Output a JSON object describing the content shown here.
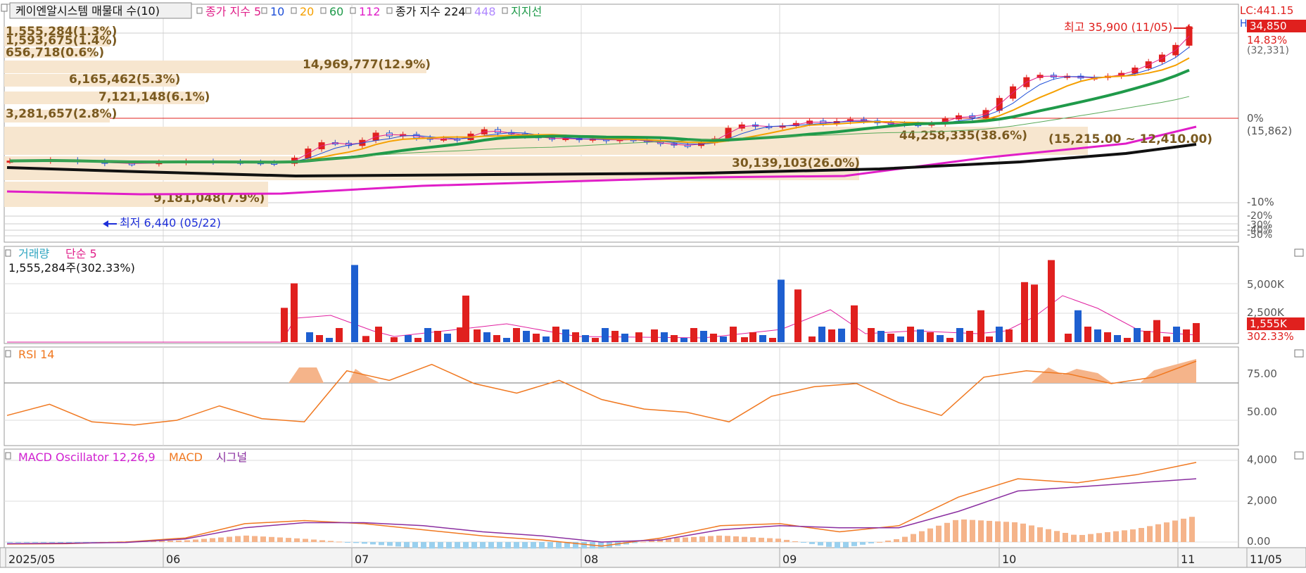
{
  "price_header": {
    "title": "케이엔알시스템 매물대 수(10)",
    "items": [
      {
        "label": "종가 지수 5",
        "color": "#e0208a"
      },
      {
        "label": "10",
        "color": "#1e4fd8"
      },
      {
        "label": "20",
        "color": "#f5a000"
      },
      {
        "label": "60",
        "color": "#1f9a4a"
      },
      {
        "label": "112",
        "color": "#e01ec8"
      },
      {
        "label": "종가 지수 224",
        "color": "#111111"
      },
      {
        "label": "448",
        "color": "#b088ff"
      },
      {
        "label": "지지선",
        "color": "#1f9a4a"
      }
    ]
  },
  "price_right": {
    "lc": "LC:441.15",
    "h": "H",
    "current": "34,850",
    "pct": "14.83%",
    "sub": "(32,331)",
    "zero": "0%",
    "zero_val": "(15,862)",
    "m10": "-10%",
    "m20": "-20%",
    "m30": "-30%",
    "m40": "-40%",
    "m50": "-50%"
  },
  "volume_profile": [
    "1,555,284(1.3%)",
    "1,593,675(1.4%)",
    "656,718(0.6%)",
    "14,969,777(12.9%)",
    "6,165,462(5.3%)",
    "7,121,148(6.1%)",
    "3,281,657(2.8%)",
    "44,258,335(38.6%)",
    "30,139,103(26.0%)",
    "9,181,048(7.9%)"
  ],
  "annotations": {
    "high": "최고 35,900 (11/05)",
    "low": "최저 6,440 (05/22)",
    "range": "(15,215.00 ~ 12,410.00)"
  },
  "volume_panel": {
    "title": "거래량",
    "ma_label": "단순 5",
    "value": "1,555,284주(302.33%)",
    "ticks": [
      "5,000K",
      "2,500K"
    ],
    "cur": "1,555K",
    "cur_pct": "302.33%"
  },
  "rsi_panel": {
    "title": "RSI 14",
    "ticks": [
      "75.00",
      "50.00"
    ]
  },
  "macd_panel": {
    "title1": "MACD Oscillator 12,26,9",
    "title2": "MACD",
    "title3": "시그널",
    "ticks": [
      "4,000",
      "2,000",
      "0.00"
    ]
  },
  "x_axis": {
    "labels": [
      "2025/05",
      "06",
      "07",
      "08",
      "09",
      "10",
      "11",
      "11/05"
    ]
  },
  "chart_data": [
    {
      "type": "candlestick",
      "title": "케이엔알시스템",
      "x": [
        "2025/05",
        "06",
        "07",
        "08",
        "09",
        "10",
        "11"
      ],
      "series": [
        {
          "name": "종가 지수 5",
          "values": [
            6900,
            6700,
            11500,
            12000,
            13000,
            14000,
            20000,
            27500,
            31000
          ]
        },
        {
          "name": "224",
          "values": [
            11000,
            10600,
            10500,
            10800,
            11200,
            11300,
            11700,
            13600,
            14600
          ]
        }
      ],
      "annotations": {
        "high": 35900,
        "high_date": "11/05",
        "low": 6440,
        "low_date": "05/22",
        "current": 34850,
        "change_pct": 14.83
      }
    },
    {
      "type": "bar",
      "title": "거래량",
      "values_k": [
        0,
        0,
        2800,
        4800,
        6300,
        500,
        400,
        1200,
        3800,
        800,
        400,
        5100,
        4300,
        1100,
        3000,
        2600,
        4900,
        4700,
        6700,
        2600,
        1800,
        1555
      ],
      "ylim_k": [
        0,
        6900
      ]
    },
    {
      "type": "line",
      "title": "RSI 14",
      "ylim": [
        30,
        90
      ],
      "values": [
        48,
        55,
        44,
        42,
        45,
        54,
        46,
        44,
        76,
        70,
        80,
        68,
        62,
        70,
        58,
        52,
        50,
        44,
        60,
        66,
        68,
        56,
        48,
        72,
        76,
        74,
        68,
        72,
        82
      ]
    },
    {
      "type": "line",
      "title": "MACD Oscillator 12,26,9",
      "ylim": [
        -500,
        4300
      ],
      "series": [
        {
          "name": "MACD",
          "values": [
            -100,
            -80,
            0,
            200,
            900,
            1050,
            900,
            600,
            300,
            100,
            -200,
            200,
            800,
            900,
            500,
            800,
            2200,
            3100,
            2900,
            3300,
            3900
          ]
        },
        {
          "name": "시그널",
          "values": [
            -80,
            -60,
            -20,
            150,
            700,
            950,
            950,
            800,
            500,
            300,
            0,
            100,
            600,
            800,
            700,
            700,
            1500,
            2500,
            2700,
            2900,
            3100
          ]
        }
      ]
    }
  ]
}
